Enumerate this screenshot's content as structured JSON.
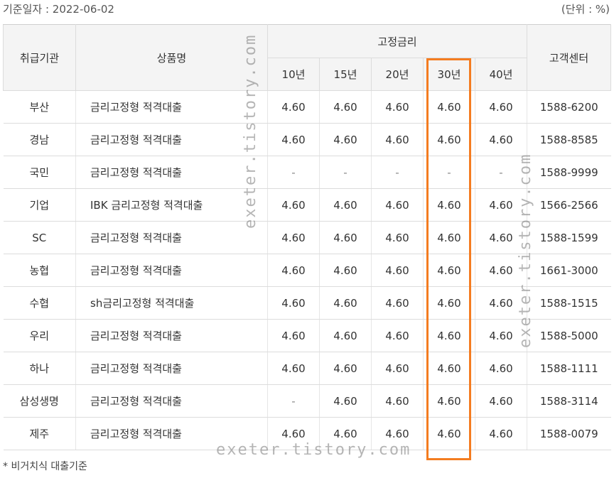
{
  "meta": {
    "date_label": "기준일자 : 2022-06-02",
    "unit_label": "(단위 : %)"
  },
  "table": {
    "headers": {
      "institution": "취급기관",
      "product": "상품명",
      "fixed_rate_group": "고정금리",
      "customer_center": "고객센터",
      "terms": [
        "10년",
        "15년",
        "20년",
        "30년",
        "40년"
      ]
    },
    "rows": [
      {
        "institution": "부산",
        "product": "금리고정형 적격대출",
        "rates": [
          "4.60",
          "4.60",
          "4.60",
          "4.60",
          "4.60"
        ],
        "phone": "1588-6200"
      },
      {
        "institution": "경남",
        "product": "금리고정형 적격대출",
        "rates": [
          "4.60",
          "4.60",
          "4.60",
          "4.60",
          "4.60"
        ],
        "phone": "1588-8585"
      },
      {
        "institution": "국민",
        "product": "금리고정형 적격대출",
        "rates": [
          "-",
          "-",
          "-",
          "-",
          "-"
        ],
        "phone": "1588-9999"
      },
      {
        "institution": "기업",
        "product": "IBK 금리고정형 적격대출",
        "rates": [
          "4.60",
          "4.60",
          "4.60",
          "4.60",
          "4.60"
        ],
        "phone": "1566-2566"
      },
      {
        "institution": "SC",
        "product": "금리고정형 적격대출",
        "rates": [
          "4.60",
          "4.60",
          "4.60",
          "4.60",
          "4.60"
        ],
        "phone": "1588-1599"
      },
      {
        "institution": "농협",
        "product": "금리고정형 적격대출",
        "rates": [
          "4.60",
          "4.60",
          "4.60",
          "4.60",
          "4.60"
        ],
        "phone": "1661-3000"
      },
      {
        "institution": "수협",
        "product": "sh금리고정형 적격대출",
        "rates": [
          "4.60",
          "4.60",
          "4.60",
          "4.60",
          "4.60"
        ],
        "phone": "1588-1515"
      },
      {
        "institution": "우리",
        "product": "금리고정형 적격대출",
        "rates": [
          "4.60",
          "4.60",
          "4.60",
          "4.60",
          "4.60"
        ],
        "phone": "1588-5000"
      },
      {
        "institution": "하나",
        "product": "금리고정형 적격대출",
        "rates": [
          "4.60",
          "4.60",
          "4.60",
          "4.60",
          "4.60"
        ],
        "phone": "1588-1111"
      },
      {
        "institution": "삼성생명",
        "product": "금리고정형 적격대출",
        "rates": [
          "-",
          "4.60",
          "4.60",
          "4.60",
          "4.60"
        ],
        "phone": "1588-3114"
      },
      {
        "institution": "제주",
        "product": "금리고정형 적격대출",
        "rates": [
          "4.60",
          "4.60",
          "4.60",
          "4.60",
          "4.60"
        ],
        "phone": "1588-0079"
      }
    ]
  },
  "footnote": "* 비거치식 대출기준",
  "watermark": "exeter.tistory.com",
  "colors": {
    "highlight": "#f47c20",
    "header_bg": "#f4f4f4"
  }
}
